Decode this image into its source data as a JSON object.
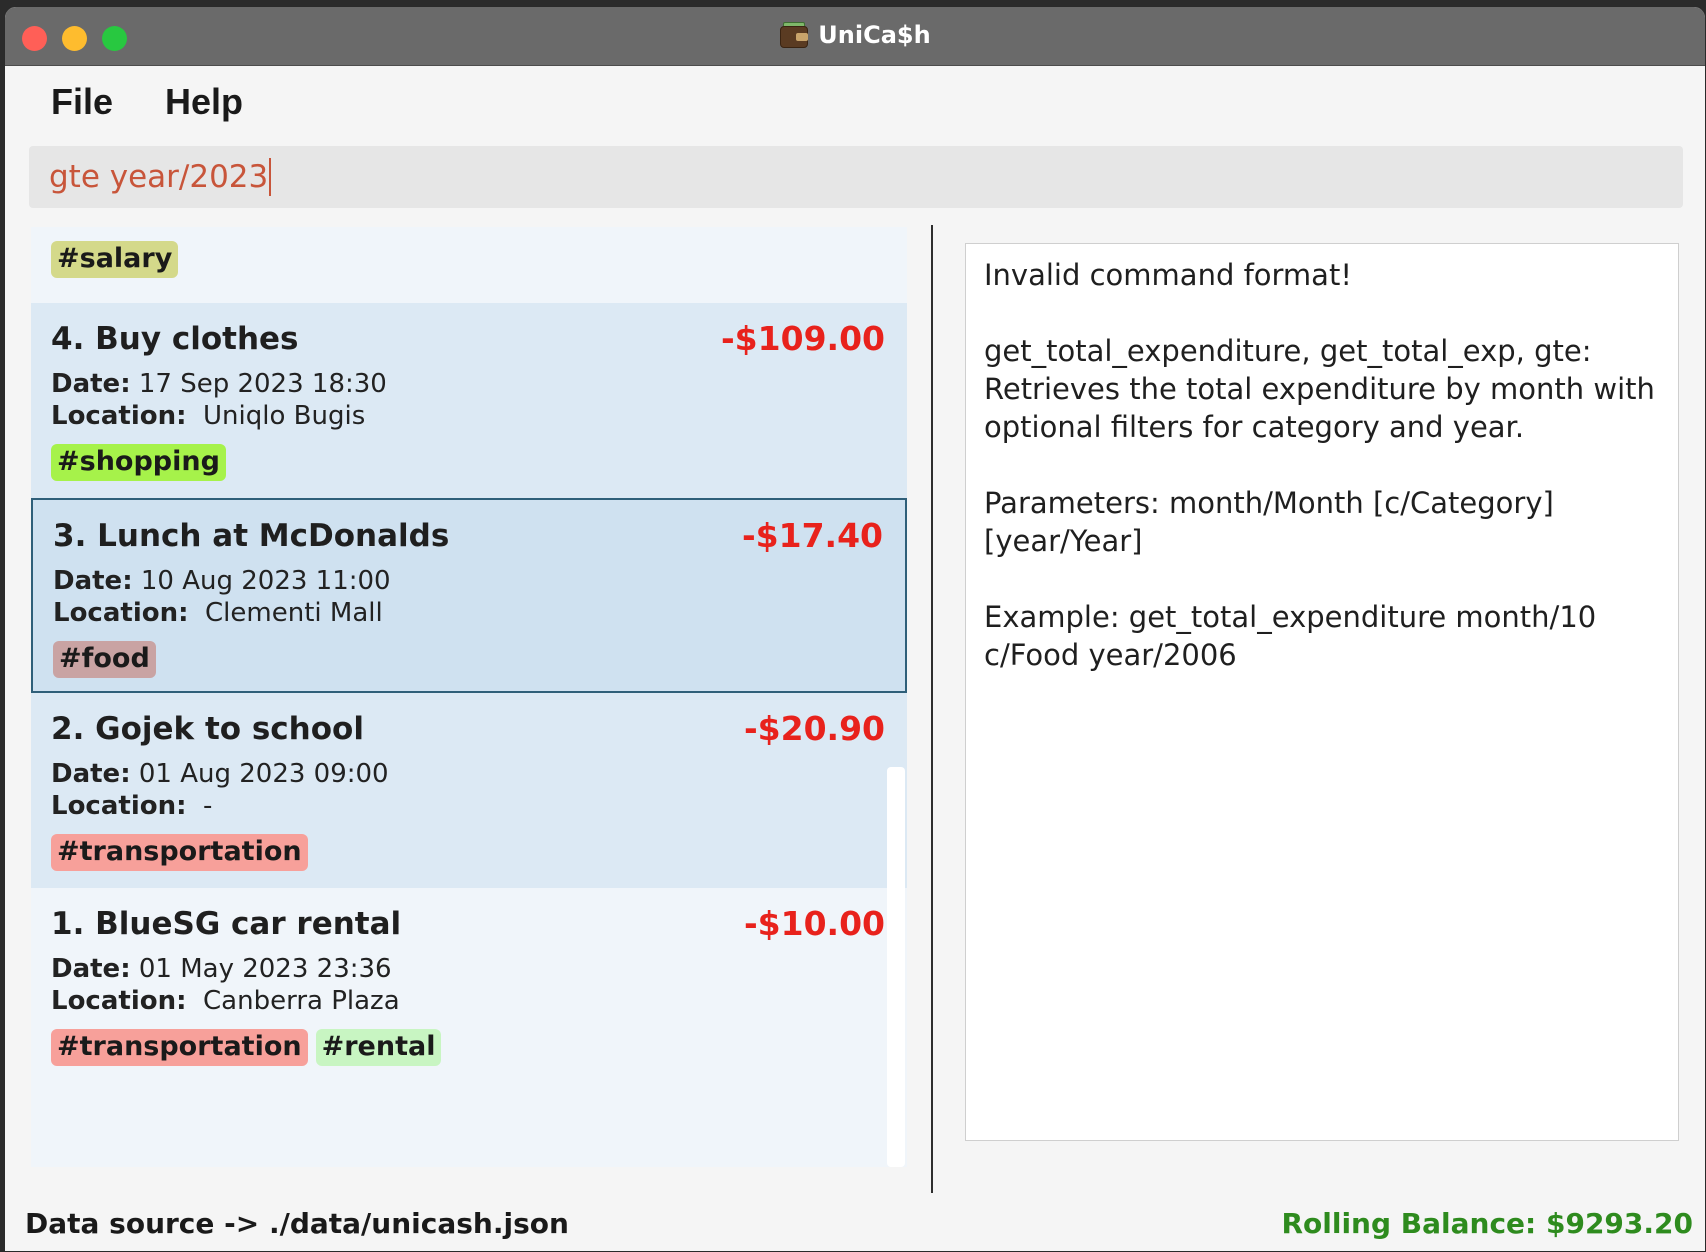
{
  "window": {
    "title": "UniCa$h",
    "app_icon": "wallet-icon"
  },
  "menu": {
    "file": "File",
    "help": "Help"
  },
  "command": {
    "value": "gte year/2023"
  },
  "transactions": [
    {
      "partial_tag": "#salary",
      "tag_color": "#d4d98a"
    },
    {
      "name": "4. Buy clothes",
      "amount": "-$109.00",
      "date_label": "Date:",
      "date": "17 Sep 2023 18:30",
      "location_label": "Location:",
      "location": "Uniqlo Bugis",
      "tags": [
        {
          "label": "#shopping",
          "color": "#a6f24a"
        }
      ]
    },
    {
      "name": "3. Lunch at McDonalds",
      "amount": "-$17.40",
      "date_label": "Date:",
      "date": "10 Aug 2023 11:00",
      "location_label": "Location:",
      "location": "Clementi Mall",
      "tags": [
        {
          "label": "#food",
          "color": "#c9a3a3"
        }
      ]
    },
    {
      "name": "2. Gojek to school",
      "amount": "-$20.90",
      "date_label": "Date:",
      "date": "01 Aug 2023 09:00",
      "location_label": "Location:",
      "location": "-",
      "tags": [
        {
          "label": "#transportation",
          "color": "#f7a09a"
        }
      ]
    },
    {
      "name": "1. BlueSG car rental",
      "amount": "-$10.00",
      "date_label": "Date:",
      "date": "01 May 2023 23:36",
      "location_label": "Location:",
      "location": "Canberra Plaza",
      "tags": [
        {
          "label": "#transportation",
          "color": "#f7a09a"
        },
        {
          "label": "#rental",
          "color": "#c8f5c2"
        }
      ]
    }
  ],
  "result": {
    "text": "Invalid command format!\n\nget_total_expenditure, get_total_exp, gte:\nRetrieves the total expenditure by month with\noptional filters for category and year.\n\nParameters: month/Month [c/Category]\n[year/Year]\n\nExample: get_total_expenditure month/10\nc/Food year/2006"
  },
  "status": {
    "data_source": "Data source -> ./data/unicash.json",
    "rolling_balance": "Rolling Balance: $9293.20"
  },
  "colors": {
    "amount": "#e8221c",
    "balance": "#2e8b1e",
    "command_text": "#c8553a",
    "card_bg_alt": "#dce9f4",
    "card_bg_selected": "#cfe1f0",
    "card_bg_plain": "#f0f5fa"
  }
}
